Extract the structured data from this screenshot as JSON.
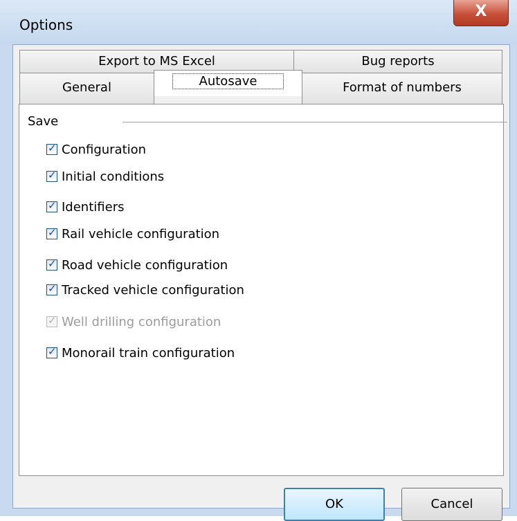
{
  "window": {
    "title": "Options",
    "close_label": "X"
  },
  "tabs": {
    "row1": [
      {
        "label": "Export to MS Excel"
      },
      {
        "label": "Bug reports"
      }
    ],
    "row2": [
      {
        "label": "General"
      },
      {
        "label": "Autosave",
        "active": true
      },
      {
        "label": "Format of numbers"
      }
    ]
  },
  "group": {
    "label": "Save"
  },
  "checkboxes": [
    {
      "label": "Configuration",
      "checked": true,
      "enabled": true
    },
    {
      "label": "Initial conditions",
      "checked": true,
      "enabled": true
    },
    {
      "label": "Identifiers",
      "checked": true,
      "enabled": true
    },
    {
      "label": "Rail vehicle configuration",
      "checked": true,
      "enabled": true
    },
    {
      "label": "Road vehicle configuration",
      "checked": true,
      "enabled": true
    },
    {
      "label": "Tracked vehicle configuration",
      "checked": true,
      "enabled": true
    },
    {
      "label": "Well drilling configuration",
      "checked": true,
      "enabled": false
    },
    {
      "label": "Monorail train configuration",
      "checked": true,
      "enabled": true
    }
  ],
  "buttons": {
    "ok": "OK",
    "cancel": "Cancel"
  }
}
